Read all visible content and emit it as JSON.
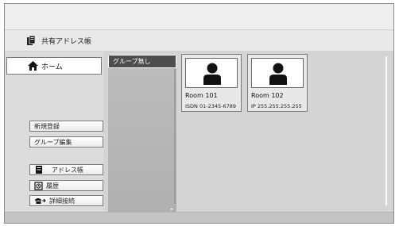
{
  "header": {
    "title": "共有アドレス帳",
    "icon": "address-book-icon"
  },
  "left": {
    "home_label": "ホーム",
    "buttons": {
      "new_registration": "新規登録",
      "group_edit": "グループ編集",
      "address_book": "アドレス帳",
      "history": "履歴",
      "detail_connect": "詳細接続"
    }
  },
  "groups": {
    "selected": "グループ無し"
  },
  "cards": [
    {
      "name": "Room 101",
      "address": "ISDN 01-2345-6789"
    },
    {
      "name": "Room 102",
      "address": "IP 255.255.255.255"
    }
  ],
  "colors": {
    "selected_bg": "#4d4d4d",
    "panel_bg": "#d4d4d4",
    "group_bg": "#b5b5b5"
  }
}
